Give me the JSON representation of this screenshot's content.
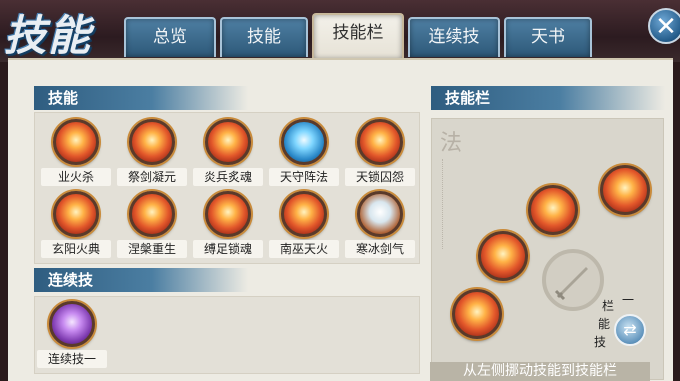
{
  "window": {
    "logo_text": "技能",
    "close_icon": "close-x-icon"
  },
  "tabs": [
    {
      "label": "总览",
      "active": false
    },
    {
      "label": "技能",
      "active": false
    },
    {
      "label": "技能栏",
      "active": true
    },
    {
      "label": "连续技",
      "active": false
    },
    {
      "label": "天书",
      "active": false
    }
  ],
  "skills_section": {
    "title": "技能",
    "items": [
      {
        "label": "业火杀",
        "icon": "fire-slash-icon"
      },
      {
        "label": "祭剑凝元",
        "icon": "sword-ritual-icon"
      },
      {
        "label": "炎兵炙魂",
        "icon": "flame-soldier-icon"
      },
      {
        "label": "天守阵法",
        "icon": "blue-shield-icon"
      },
      {
        "label": "天锁囚怨",
        "icon": "chain-prison-icon"
      },
      {
        "label": "玄阳火典",
        "icon": "sun-fire-icon"
      },
      {
        "label": "涅槃重生",
        "icon": "rebirth-icon"
      },
      {
        "label": "缚足锁魂",
        "icon": "bind-soul-icon"
      },
      {
        "label": "南巫天火",
        "icon": "sky-fire-icon"
      },
      {
        "label": "寒冰剑气",
        "icon": "ice-sword-icon"
      }
    ]
  },
  "combo_section": {
    "title": "连续技",
    "items": [
      {
        "label": "连续技一",
        "icon": "combo-purple-icon"
      }
    ]
  },
  "skillbar_section": {
    "title": "技能栏",
    "background_glyph": "法",
    "switch_label_chars": [
      "栏",
      "一",
      "能",
      "技"
    ],
    "switch_icon": "swap-arrows-icon",
    "hint": "从左侧挪动技能到技能栏"
  },
  "colors": {
    "tab_blue": "#2d5878",
    "panel": "#edebe3",
    "section_blue": "#2f5d80"
  }
}
